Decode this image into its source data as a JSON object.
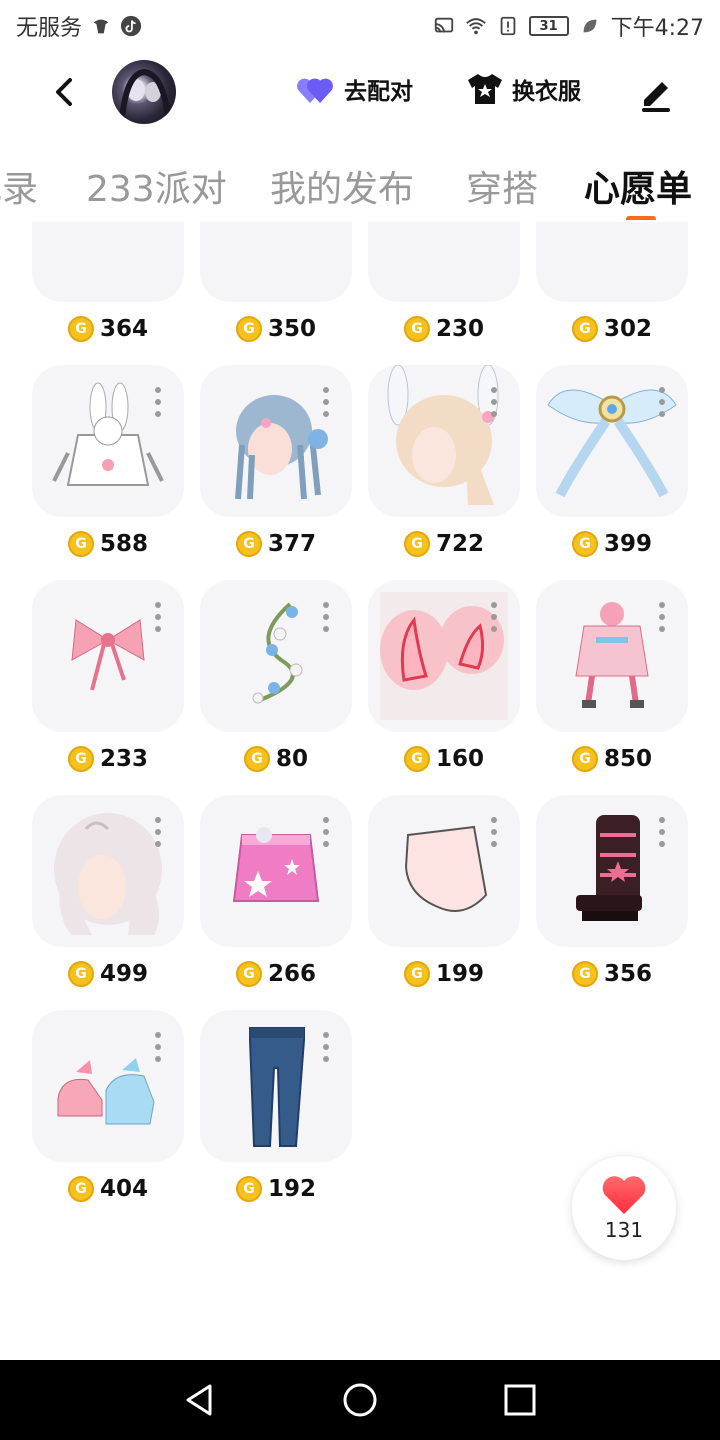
{
  "status_bar": {
    "carrier": "无服务",
    "time": "下午4:27",
    "battery": "31"
  },
  "header": {
    "match_label": "去配对",
    "outfit_label": "换衣服"
  },
  "tabs": [
    {
      "label": "记录",
      "active": false
    },
    {
      "label": "233派对",
      "active": false
    },
    {
      "label": "我的发布",
      "active": false
    },
    {
      "label": "穿搭",
      "active": false
    },
    {
      "label": "心愿单",
      "active": true
    }
  ],
  "wishlist": {
    "currency_glyph": "G",
    "items": [
      {
        "price": "364",
        "kind": "hair-dark-bun",
        "has_menu": false
      },
      {
        "price": "350",
        "kind": "shoes-white",
        "has_menu": false
      },
      {
        "price": "230",
        "kind": "dress-pink",
        "has_menu": false
      },
      {
        "price": "302",
        "kind": "outfit-colorful",
        "has_menu": false
      },
      {
        "price": "588",
        "kind": "bunny-hoodie",
        "has_menu": true
      },
      {
        "price": "377",
        "kind": "hair-blue-braids",
        "has_menu": true
      },
      {
        "price": "722",
        "kind": "hair-blonde-bunny",
        "has_menu": true
      },
      {
        "price": "399",
        "kind": "wing-ornament",
        "has_menu": true
      },
      {
        "price": "233",
        "kind": "pink-bow",
        "has_menu": true
      },
      {
        "price": "80",
        "kind": "flower-vine",
        "has_menu": true
      },
      {
        "price": "160",
        "kind": "devil-horns",
        "has_menu": true
      },
      {
        "price": "850",
        "kind": "outfit-pink-idol",
        "has_menu": true
      },
      {
        "price": "499",
        "kind": "hair-silver",
        "has_menu": true
      },
      {
        "price": "266",
        "kind": "skirt-pink-star",
        "has_menu": true
      },
      {
        "price": "199",
        "kind": "face-blush",
        "has_menu": true
      },
      {
        "price": "356",
        "kind": "boots-star",
        "has_menu": true
      },
      {
        "price": "404",
        "kind": "shoes-ribbon",
        "has_menu": true
      },
      {
        "price": "192",
        "kind": "jeans-blue",
        "has_menu": true
      }
    ]
  },
  "favorites": {
    "count": "131"
  },
  "colors": {
    "accent_orange": "#ff6a1a",
    "heart_red": "#ff3344",
    "match_purple": "#6b5cf6",
    "coin_gold": "#f6c11d"
  }
}
